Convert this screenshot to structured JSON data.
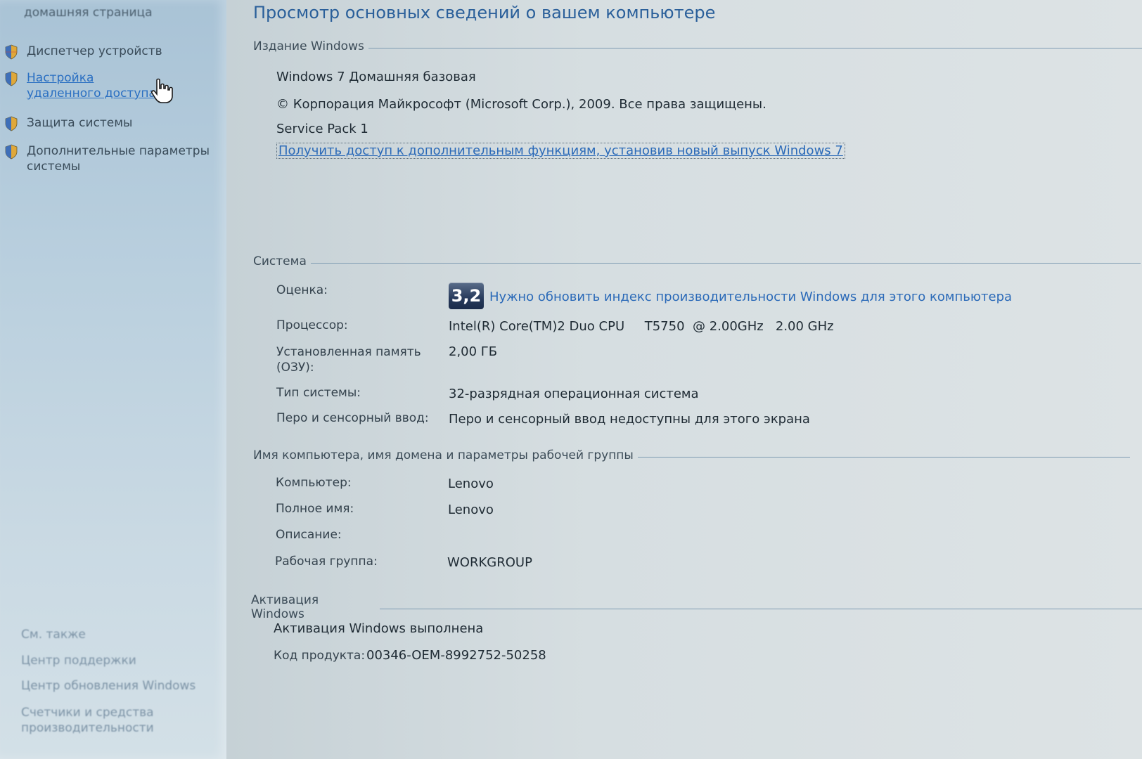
{
  "sidebar": {
    "top_text": "домашняя страница",
    "items": [
      {
        "label": "Диспетчер устройств",
        "icon": "shield-icon",
        "link": false
      },
      {
        "label": "Настройка удаленного доступа",
        "icon": "shield-icon",
        "link": true
      },
      {
        "label": "Защита системы",
        "icon": "shield-icon",
        "link": false
      },
      {
        "label": "Дополнительные параметры системы",
        "icon": "shield-icon",
        "link": false
      }
    ],
    "see_also": {
      "heading": "См. также",
      "items": [
        "Центр поддержки",
        "Центр обновления Windows",
        "Счетчики и средства производительности"
      ]
    }
  },
  "main": {
    "title": "Просмотр основных сведений о вашем компьютере",
    "edition": {
      "heading": "Издание Windows",
      "name": "Windows 7 Домашняя базовая",
      "copyright": "© Корпорация Майкрософт (Microsoft Corp.), 2009. Все права защищены.",
      "service_pack": "Service Pack 1",
      "upgrade_link": "Получить доступ к дополнительным функциям, установив новый выпуск Windows 7"
    },
    "system": {
      "heading": "Система",
      "rating_label": "Оценка:",
      "rating_value": "3,2",
      "rating_link": "Нужно обновить индекс производительности Windows для этого компьютера",
      "cpu_label": "Процессор:",
      "cpu_value": "Intel(R) Core(TM)2 Duo CPU     T5750  @ 2.00GHz   2.00 GHz",
      "ram_label": "Установленная память (ОЗУ):",
      "ram_value": "2,00 ГБ",
      "type_label": "Тип системы:",
      "type_value": "32-разрядная операционная система",
      "pen_label": "Перо и сенсорный ввод:",
      "pen_value": "Перо и сенсорный ввод недоступны для этого экрана"
    },
    "computer": {
      "heading": "Имя компьютера, имя домена и параметры рабочей группы",
      "name_label": "Компьютер:",
      "name_value": "Lenovo",
      "full_label": "Полное имя:",
      "full_value": "Lenovo",
      "desc_label": "Описание:",
      "desc_value": "",
      "group_label": "Рабочая группа:",
      "group_value": "WORKGROUP"
    },
    "activation": {
      "heading": "Активация Windows",
      "status": "Активация Windows выполнена",
      "key_label": "Код продукта:",
      "key_value": "00346-OEM-8992752-50258"
    }
  },
  "colors": {
    "link": "#2b6ab8",
    "title": "#2a5f9a",
    "rule": "#7e9bb2"
  }
}
